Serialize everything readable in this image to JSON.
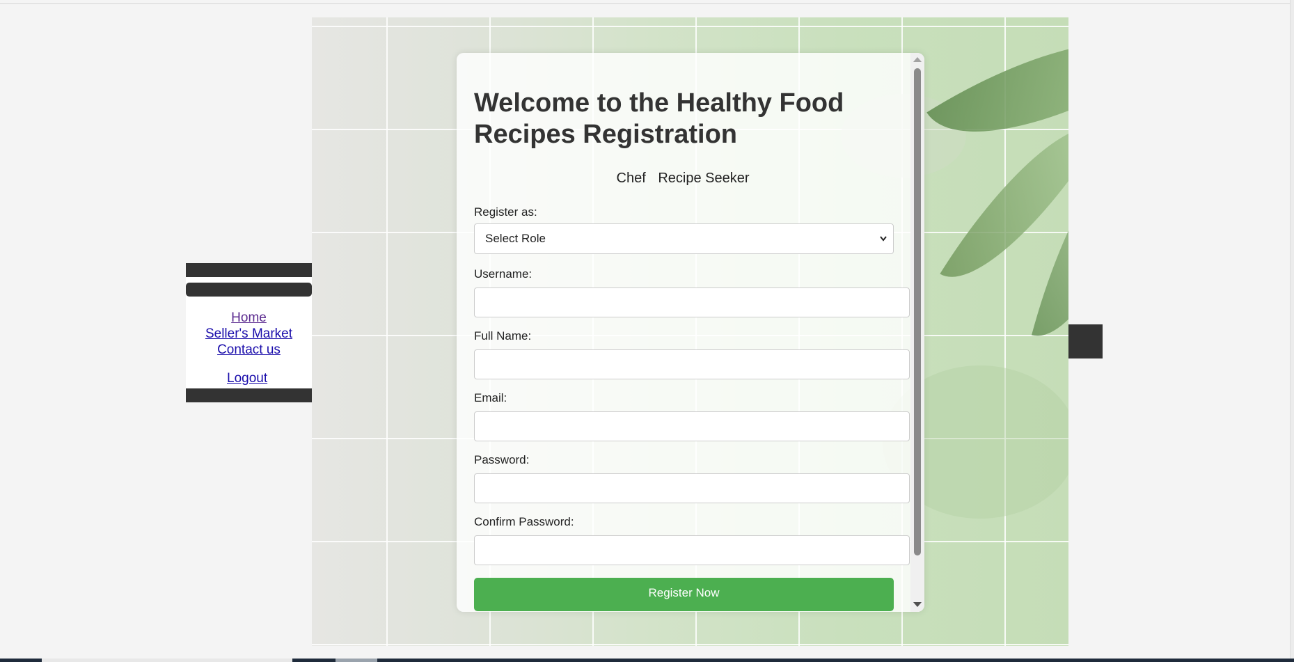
{
  "sidebar": {
    "nav": [
      "Home",
      "Seller's Market",
      "Contact us"
    ],
    "logout": "Logout"
  },
  "form": {
    "title": "Welcome to the Healthy Food Recipes Registration",
    "roles": [
      "Chef",
      "Recipe Seeker"
    ],
    "register_as_label": "Register as:",
    "role_select_value": "Select Role",
    "username_label": "Username:",
    "fullname_label": "Full Name:",
    "email_label": "Email:",
    "password_label": "Password:",
    "confirm_password_label": "Confirm Password:",
    "submit_label": "Register Now"
  },
  "colors": {
    "accent": "#4caf50",
    "dark_bars": "#333333",
    "link": "#1a0dab",
    "visited_link": "#5b2a8f"
  },
  "icons": [
    "chevron-down-icon",
    "scroll-up-arrow-icon",
    "scroll-down-arrow-icon"
  ]
}
